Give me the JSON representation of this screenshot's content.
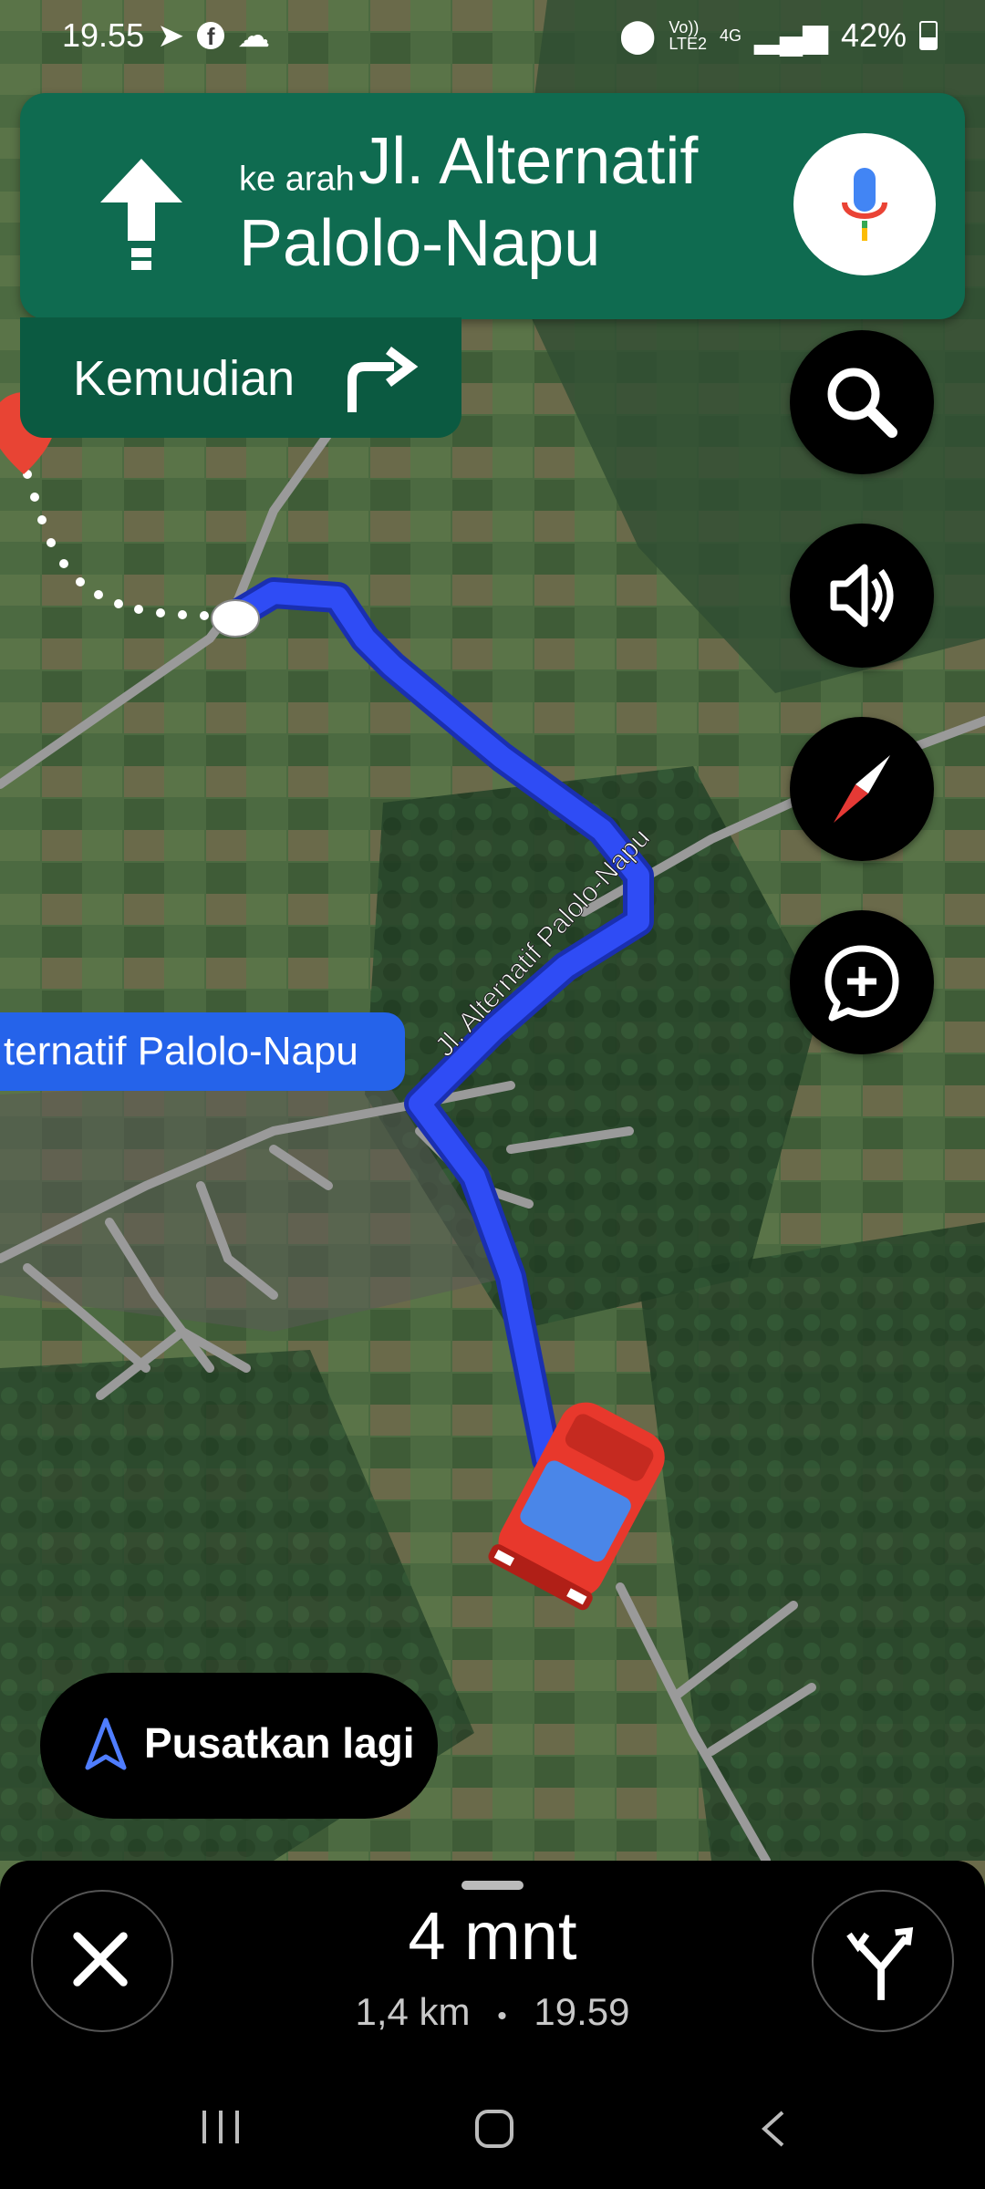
{
  "status_bar": {
    "time": "19.55",
    "network": "4G",
    "lte_top": "Vo))",
    "lte_bottom": "LTE2",
    "battery": "42%"
  },
  "navigation": {
    "direction_prefix": "ke arah",
    "street_line1": "Jl. Alternatif",
    "street_line2": "Palolo-Napu",
    "then_label": "Kemudian"
  },
  "map": {
    "road_label_on_route": "Jl. Alternatif Palolo-Napu",
    "current_road": "ternatif Palolo-Napu"
  },
  "recenter": {
    "label": "Pusatkan lagi"
  },
  "trip": {
    "eta_duration": "4 mnt",
    "distance": "1,4 km",
    "separator": "•",
    "arrival_time": "19.59"
  },
  "colors": {
    "banner": "#0f6b50",
    "route": "#2f4cf5",
    "car": "#e8382c"
  }
}
